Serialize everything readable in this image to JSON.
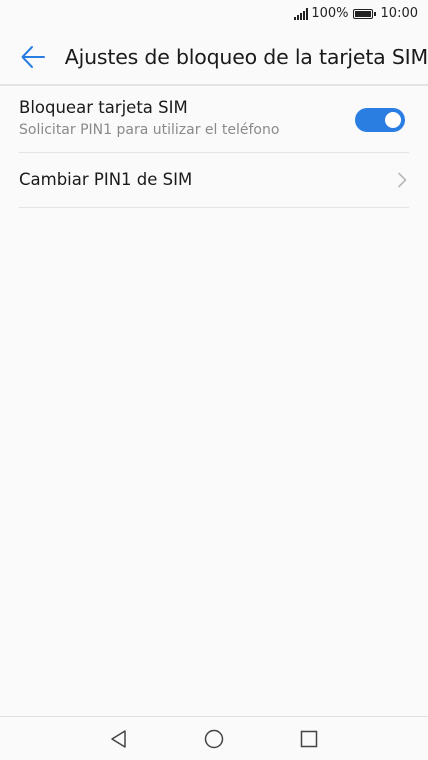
{
  "status_bar": {
    "battery": "100%",
    "time": "10:00"
  },
  "header": {
    "title": "Ajustes de bloqueo de la tarjeta SIM",
    "back_icon": "arrow-left-icon"
  },
  "settings": {
    "lock_sim": {
      "title": "Bloquear tarjeta SIM",
      "subtitle": "Solicitar PIN1 para utilizar el teléfono",
      "enabled": true
    },
    "change_pin": {
      "title": "Cambiar PIN1 de SIM",
      "icon": "chevron-right-icon"
    }
  },
  "nav_bar": {
    "back_icon": "triangle-back-icon",
    "home_icon": "circle-home-icon",
    "recent_icon": "square-recent-icon"
  },
  "colors": {
    "accent": "#2a7de1",
    "background": "#fafafa"
  }
}
